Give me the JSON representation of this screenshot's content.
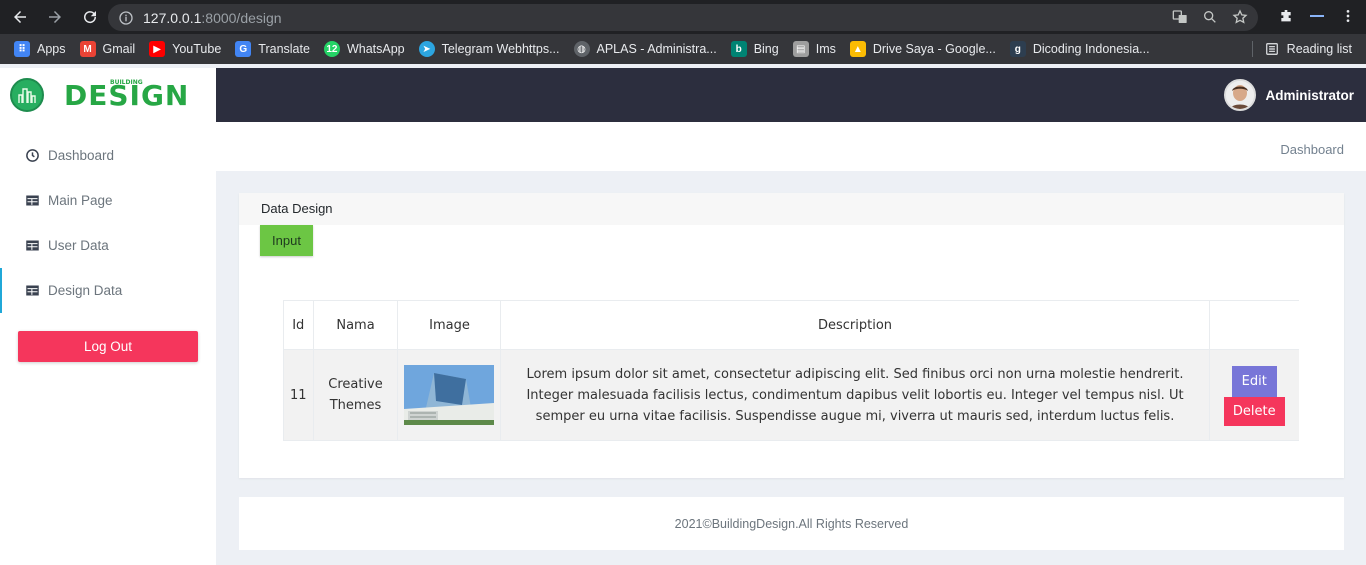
{
  "browser": {
    "url_host": "127.0.0.1",
    "url_rest": ":8000/design",
    "bookmarks": [
      {
        "label": "Apps",
        "color": "#4285f4",
        "glyph": "⋮"
      },
      {
        "label": "Gmail",
        "color": "#ea4335",
        "glyph": "M"
      },
      {
        "label": "YouTube",
        "color": "#ff0000",
        "glyph": "▶"
      },
      {
        "label": "Translate",
        "color": "#4285f4",
        "glyph": "G"
      },
      {
        "label": "WhatsApp",
        "color": "#25d366",
        "glyph": "12"
      },
      {
        "label": "Telegram Webhttps...",
        "color": "#2ca5e0",
        "glyph": "➤"
      },
      {
        "label": "APLAS - Administra...",
        "color": "#5f6368",
        "glyph": "◍"
      },
      {
        "label": "Bing",
        "color": "#008373",
        "glyph": "b"
      },
      {
        "label": "Ims",
        "color": "#9e9e9e",
        "glyph": "▤"
      },
      {
        "label": "Drive Saya - Google...",
        "color": "#fbbc04",
        "glyph": "▲"
      },
      {
        "label": "Dicoding Indonesia...",
        "color": "#2d3e50",
        "glyph": "g"
      }
    ],
    "reading_list": "Reading list"
  },
  "sidebar": {
    "logo_text": "DESIGN",
    "logo_small": "BUILDING",
    "items": [
      {
        "label": "Dashboard",
        "icon": "clock-icon"
      },
      {
        "label": "Main Page",
        "icon": "table-icon"
      },
      {
        "label": "User Data",
        "icon": "table-icon"
      },
      {
        "label": "Design Data",
        "icon": "table-icon"
      }
    ],
    "logout_label": "Log Out"
  },
  "topbar": {
    "user_name": "Administrator"
  },
  "breadcrumb": "Dashboard",
  "card": {
    "title": "Data Design",
    "input_label": "Input",
    "columns": [
      "Id",
      "Nama",
      "Image",
      "Description",
      ""
    ],
    "rows": [
      {
        "id": "11",
        "nama": "Creative Themes",
        "description": "Lorem ipsum dolor sit amet, consectetur adipiscing elit. Sed finibus orci non urna molestie hendrerit. Integer malesuada facilisis lectus, condimentum dapibus velit lobortis eu. Integer vel tempus nisl. Ut semper eu urna vitae facilisis. Suspendisse augue mi, viverra ut mauris sed, interdum luctus felis.",
        "edit_label": "Edit",
        "delete_label": "Delete"
      }
    ]
  },
  "footer": "2021©BuildingDesign.All Rights Reserved"
}
